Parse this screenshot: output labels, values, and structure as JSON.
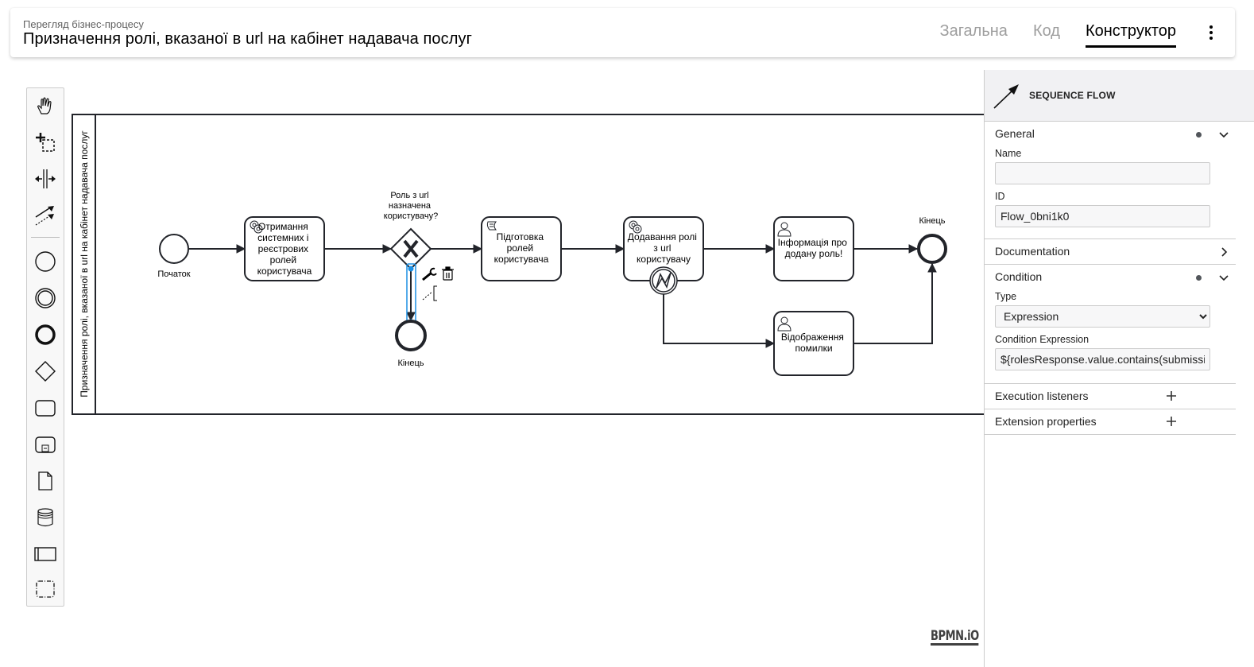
{
  "header": {
    "subtitle": "Перегляд бізнес-процесу",
    "title": "Призначення ролі, вказаної в url на кабінет надавача послуг",
    "tabs": [
      {
        "label": "Загальна",
        "active": false
      },
      {
        "label": "Код",
        "active": false
      },
      {
        "label": "Конструктор",
        "active": true
      }
    ],
    "menu_icon": "more-vert-icon"
  },
  "palette": {
    "tools": [
      {
        "name": "hand-tool",
        "icon": "hand-icon"
      },
      {
        "name": "lasso-tool",
        "icon": "lasso-icon"
      },
      {
        "name": "space-tool",
        "icon": "space-icon"
      },
      {
        "name": "global-connect-tool",
        "icon": "connect-icon"
      },
      {
        "name": "create-start-event",
        "icon": "start-event-icon"
      },
      {
        "name": "create-intermediate-event",
        "icon": "intermediate-event-icon"
      },
      {
        "name": "create-end-event",
        "icon": "end-event-icon"
      },
      {
        "name": "create-gateway",
        "icon": "gateway-icon"
      },
      {
        "name": "create-task",
        "icon": "task-icon"
      },
      {
        "name": "create-subprocess",
        "icon": "subprocess-icon"
      },
      {
        "name": "create-data-object",
        "icon": "data-object-icon"
      },
      {
        "name": "create-data-store",
        "icon": "data-store-icon"
      },
      {
        "name": "create-pool",
        "icon": "pool-icon"
      },
      {
        "name": "create-group",
        "icon": "group-icon"
      }
    ]
  },
  "diagram": {
    "pool_label": "Призначення ролі, вказаної в url на кабінет надавача послуг",
    "start_event": {
      "label": "Початок"
    },
    "task1": {
      "lines": [
        "Отримання",
        "системних і",
        "реєстрових",
        "ролей",
        "користувача"
      ],
      "type": "service"
    },
    "gateway": {
      "lines": [
        "Роль з url",
        "назначена",
        "користувачу?"
      ]
    },
    "end_event_gateway": {
      "label": "Кінець"
    },
    "task2": {
      "lines": [
        "Підготовка",
        "ролей",
        "користувача"
      ],
      "type": "script"
    },
    "task3": {
      "lines": [
        "Додавання ролі",
        "з url",
        "користувачу"
      ],
      "type": "service"
    },
    "task4": {
      "lines": [
        "Інформація про",
        "додану роль!"
      ],
      "type": "user"
    },
    "task5": {
      "lines": [
        "Відображення",
        "помилки"
      ],
      "type": "user"
    },
    "end_event_main": {
      "label": "Кінець"
    },
    "watermark": "BPMN.iO"
  },
  "properties": {
    "element_type": "SEQUENCE FLOW",
    "groups": {
      "general": {
        "label": "General",
        "name_label": "Name",
        "name_value": "",
        "id_label": "ID",
        "id_value": "Flow_0bni1k0"
      },
      "documentation": {
        "label": "Documentation"
      },
      "condition": {
        "label": "Condition",
        "type_label": "Type",
        "type_value": "Expression",
        "expression_label": "Condition Expression",
        "expression_value": "${rolesResponse.value.contains(submissi"
      },
      "execution_listeners": {
        "label": "Execution listeners"
      },
      "extension_properties": {
        "label": "Extension properties"
      }
    }
  }
}
